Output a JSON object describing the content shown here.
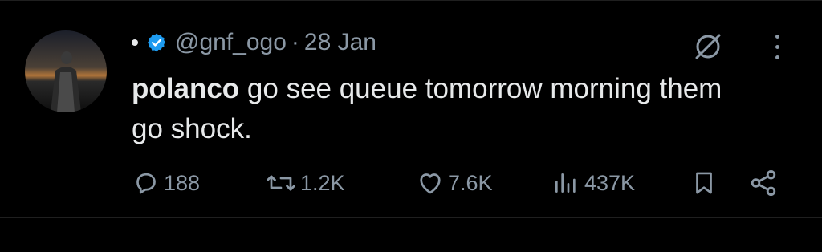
{
  "tweet": {
    "handle": "@gnf_ogo",
    "separator": "·",
    "date": "28 Jan",
    "mention": "polanco",
    "text": " go see queue tomorrow morning them go shock."
  },
  "actions": {
    "replies": "188",
    "reposts": "1.2K",
    "likes": "7.6K",
    "views": "437K"
  },
  "icons": {
    "status_dot": "status-dot",
    "verified": "verified-badge-icon",
    "grok": "grok-icon",
    "more": "more-options-icon",
    "reply": "reply-icon",
    "repost": "repost-icon",
    "like": "heart-icon",
    "views": "views-icon",
    "bookmark": "bookmark-icon",
    "share": "share-icon"
  },
  "colors": {
    "background": "#000000",
    "text_primary": "#e7e9ea",
    "text_secondary": "#8b98a5",
    "verified": "#1d9bf0"
  }
}
